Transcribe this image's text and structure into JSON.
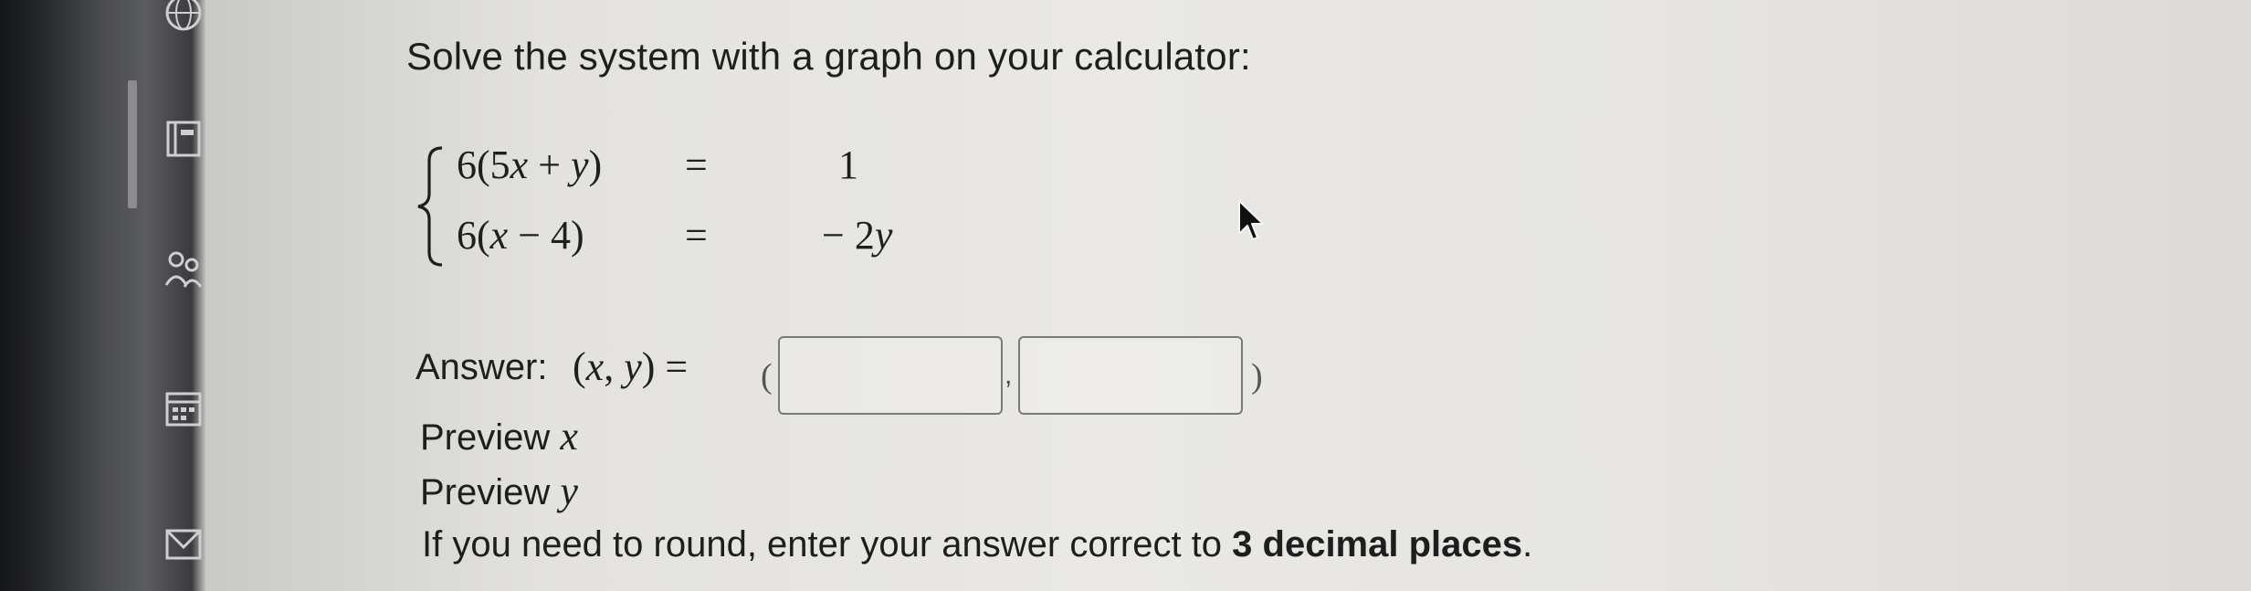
{
  "question": {
    "prompt": "Solve the system with a graph on your calculator:"
  },
  "system": {
    "equations": [
      {
        "lhs": "6(5x + y)",
        "op": "=",
        "rhs": "1"
      },
      {
        "lhs": "6(x − 4)",
        "op": "=",
        "rhs": "− 2y"
      }
    ]
  },
  "answer": {
    "label": "Answer:",
    "math": "(x, y) =",
    "open_paren": "(",
    "separator": ",",
    "close_paren": ")",
    "x_value": "",
    "y_value": ""
  },
  "preview": {
    "x_label": "Preview",
    "x_var": "x",
    "y_label": "Preview",
    "y_var": "y"
  },
  "instructions": {
    "before": "If you need to round, enter your answer correct to ",
    "bold": "3 decimal places",
    "after": "."
  },
  "sidebar": {
    "icons": [
      "globe-icon",
      "book-icon",
      "people-icon",
      "calendar-icon",
      "inbox-icon"
    ]
  }
}
